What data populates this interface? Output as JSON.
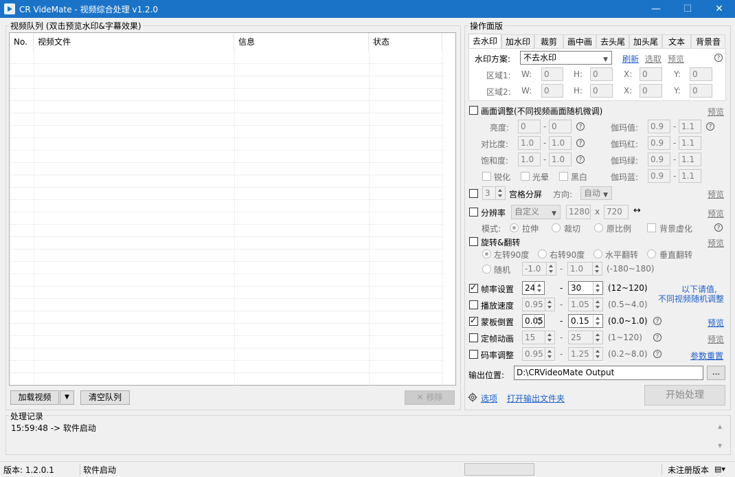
{
  "window": {
    "title": "CR VideMate - 视频综合处理 v1.2.0",
    "minimize": "—",
    "maximize": "☐",
    "close": "✕"
  },
  "queue": {
    "legend": "视频队列 (双击预览水印&字幕效果)",
    "columns": [
      "No.",
      "视频文件",
      "信息",
      "状态"
    ],
    "load_button": "加载视频",
    "clear_button": "清空队列",
    "remove_button": "✕ 移除"
  },
  "panel": {
    "legend": "操作面版",
    "tabs": [
      "去水印",
      "加水印",
      "裁剪",
      "画中画",
      "去头尾",
      "加头尾",
      "文本",
      "背景音"
    ],
    "watermark": {
      "scheme_label": "水印方案:",
      "scheme_value": "不去水印",
      "refresh": "刷新",
      "select": "选取",
      "preview": "预览",
      "area1": "区域1:",
      "area2": "区域2:",
      "w": "W:",
      "h": "H:",
      "x": "X:",
      "y": "Y:",
      "zero": "0"
    },
    "image_adjust": {
      "label": "画面调整(不同视频画面随机微调)",
      "preview": "预览",
      "brightness": "亮度:",
      "contrast": "对比度:",
      "saturation": "饱和度:",
      "gamma": "伽玛值:",
      "gamma_r": "伽玛红:",
      "gamma_g": "伽玛绿:",
      "gamma_b": "伽玛蓝:",
      "b_min": "0",
      "b_max": "0",
      "c_min": "1.0",
      "c_max": "1.0",
      "s_min": "1.0",
      "s_max": "1.0",
      "g_min": "0.9",
      "g_max": "1.1",
      "sharpen": "锐化",
      "halo": "光晕",
      "bw": "黑白",
      "dash": "-"
    },
    "grid_split": {
      "value": "3",
      "label": "宫格分屏",
      "dir_label": "方向:",
      "dir_value": "自动",
      "preview": "预览"
    },
    "resolution": {
      "label": "分辨率",
      "preset": "自定义",
      "width": "1280",
      "x": "x",
      "height": "720",
      "swap": "↔",
      "preview": "预览",
      "mode_label": "模式:",
      "stretch": "拉伸",
      "crop": "裁切",
      "ratio": "原比例",
      "blur_bg": "背景虚化"
    },
    "rotate": {
      "label": "旋转&翻转",
      "preview": "预览",
      "left90": "左转90度",
      "right90": "右转90度",
      "hflip": "水平翻转",
      "vflip": "垂直翻转",
      "random": "随机",
      "r_min": "-1.0",
      "r_max": "1.0",
      "range": "(-180~180)"
    },
    "framerate": {
      "label": "帧率设置",
      "min": "24",
      "max": "30",
      "range": "(12~120)"
    },
    "speed": {
      "label": "播放速度",
      "min": "0.95",
      "max": "1.05",
      "range": "(0.5~4.0)"
    },
    "mask": {
      "label": "蒙板倒置",
      "min": "0.05",
      "max": "0.15",
      "range": "(0.0~1.0)",
      "preview": "预览"
    },
    "fixed_frame": {
      "label": "定帧动画",
      "min": "15",
      "max": "25",
      "range": "(1~120)",
      "preview": "预览"
    },
    "bitrate": {
      "label": "码率调整",
      "min": "0.95",
      "max": "1.25",
      "range": "(0.2~8.0)",
      "reset": "参数重置"
    },
    "note_line1": "以下请值,",
    "note_line2": "不同视频随机调整",
    "output_label": "输出位置:",
    "output_path": "D:\\CRVideoMate Output",
    "browse": "...",
    "options": "选项",
    "open_output": "打开输出文件夹",
    "start": "开始处理"
  },
  "log": {
    "legend": "处理记录",
    "entry": "15:59:48 -> 软件启动"
  },
  "status": {
    "version": "版本: 1.2.0.1",
    "message": "软件启动",
    "license": "未注册版本"
  },
  "colors": {
    "titlebar": "#1a73c7",
    "link": "#1e5fc9"
  }
}
